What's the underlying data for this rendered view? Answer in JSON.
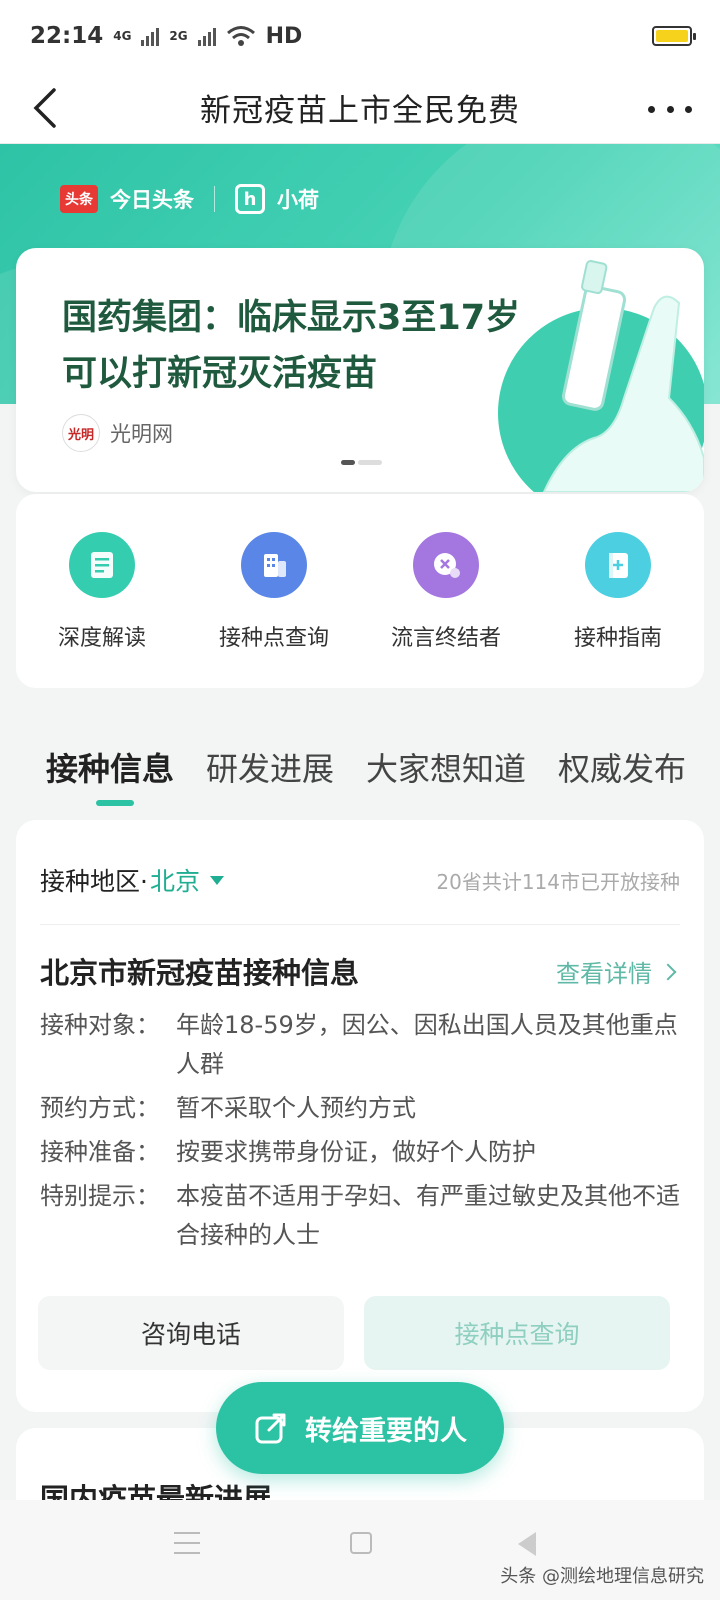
{
  "status_bar": {
    "time": "22:14",
    "network_1": "4G",
    "network_2": "2G",
    "hd": "HD",
    "battery_color": "#f6d21c"
  },
  "nav": {
    "title": "新冠疫苗上市全民免费"
  },
  "brand": {
    "toutiao_badge": "头条",
    "toutiao_name": "今日头条",
    "xiaohe_mark": "h",
    "xiaohe_name": "小荷"
  },
  "banner": {
    "title": "国药集团：临床显示3至17岁可以打新冠灭活疫苗",
    "source": "光明网",
    "source_logo_text": "光明"
  },
  "quick_links": [
    {
      "label": "深度解读",
      "icon": "document-icon",
      "color": "#34cdb0"
    },
    {
      "label": "接种点查询",
      "icon": "building-icon",
      "color": "#5a86e8"
    },
    {
      "label": "流言终结者",
      "icon": "chat-bubble-icon",
      "color": "#a476e0"
    },
    {
      "label": "接种指南",
      "icon": "guide-book-icon",
      "color": "#4ccfe0"
    }
  ],
  "tabs": [
    {
      "label": "接种信息",
      "active": true
    },
    {
      "label": "研发进展",
      "active": false
    },
    {
      "label": "大家想知道",
      "active": false
    },
    {
      "label": "权威发布",
      "active": false
    }
  ],
  "info": {
    "region_label": "接种地区·",
    "region_city": "北京",
    "open_count": "20省共计114市已开放接种",
    "section_title": "北京市新冠疫苗接种信息",
    "detail_link": "查看详情",
    "rows": [
      {
        "key": "接种对象：",
        "value": "年龄18-59岁，因公、因私出国人员及其他重点人群"
      },
      {
        "key": "预约方式：",
        "value": "暂不采取个人预约方式"
      },
      {
        "key": "接种准备：",
        "value": "按要求携带身份证，做好个人防护"
      },
      {
        "key": "特别提示：",
        "value": "本疫苗不适用于孕妇、有严重过敏史及其他不适合接种的人士"
      }
    ],
    "btn_consult": "咨询电话",
    "btn_site": "接种点查询"
  },
  "next_section": {
    "title": "国内疫苗最新进展"
  },
  "share_button": {
    "label": "转给重要的人"
  },
  "watermark": "头条 @测绘地理信息研究",
  "accent_color": "#2cc2a4"
}
